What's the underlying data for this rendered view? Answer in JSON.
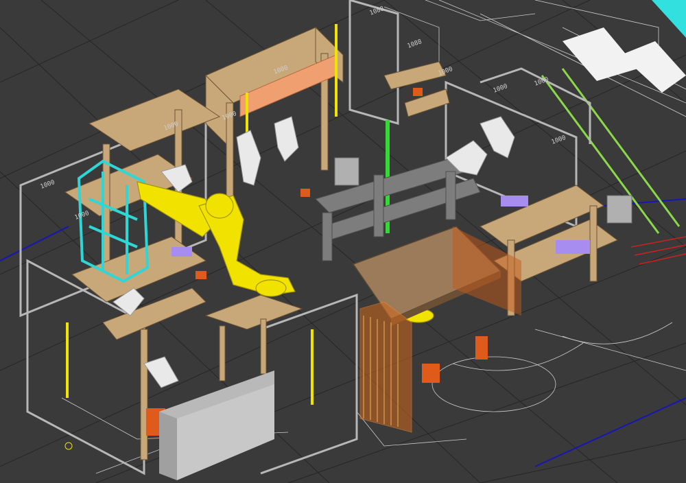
{
  "viewport": {
    "background": "#3a3a3a",
    "grid_color": "#2b2b2b",
    "drawing_line_color": "#e8e8e8"
  },
  "dimension_labels": [
    "1088",
    "1088",
    "1000",
    "1000",
    "1000",
    "1000",
    "1000",
    "1000",
    "1000",
    "1000",
    "1000"
  ],
  "palette": {
    "frame_wood": "#c8a878",
    "frame_wood_dark": "#8a6e4e",
    "guard_grey": "#a8a8a8",
    "yellow_robot": "#f2e200",
    "cyan_fixture": "#2fd6d6",
    "orange_tooling": "#e05a1a",
    "platform_brown": "#9b7b5a",
    "gantry_grey": "#7d7d7d",
    "cable_green": "#36d836",
    "salmon_panel": "#f0a070",
    "cyan_screen_corner": "#33e0e0",
    "purple_parts": "#a78df0"
  },
  "objects": [
    "wooden-frame-left",
    "wooden-frame-rear",
    "cyan-fixture",
    "yellow-robot",
    "white-robots",
    "platform-roof",
    "gantry",
    "grey-enclosure-box",
    "rail-conveyor"
  ]
}
